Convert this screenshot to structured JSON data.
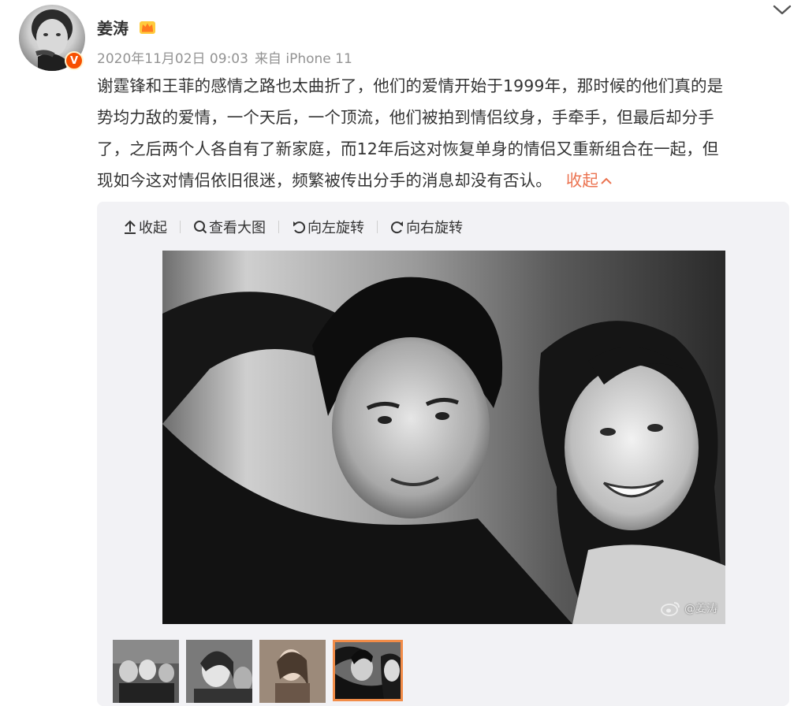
{
  "post": {
    "username": "姜涛",
    "crown_icon": "crown-badge-icon",
    "verified_label": "V",
    "timestamp": "2020年11月02日 09:03",
    "source": "来自 iPhone 11",
    "text_lines": [
      "谢霆锋和王菲的感情之路也太曲折了，他们的爱情开始于1999年，那时候的他们真的是",
      "势均力敌的爱情，一个天后，一个顶流，他们被拍到情侣纹身，手牵手，但最后却分手",
      "了，之后两个人各自有了新家庭，而12年后这对恢复单身的情侣又重新组合在一起，但",
      "现如今这对情侣依旧很迷，频繁被传出分手的消息却没有否认。"
    ],
    "collapse_label": "收起",
    "collapse_caret": "^"
  },
  "media_toolbar": {
    "collapse": "收起",
    "view_large": "查看大图",
    "rotate_left": "向左旋转",
    "rotate_right": "向右旋转"
  },
  "photo": {
    "watermark": "@姜涛"
  },
  "thumbnails": {
    "count": 4,
    "selected_index": 3
  },
  "colors": {
    "link_orange": "#eb7350",
    "meta_gray": "#939393",
    "verified_orange": "#f75000",
    "thumb_border": "#f28c48",
    "media_bg": "#f2f2f5"
  }
}
